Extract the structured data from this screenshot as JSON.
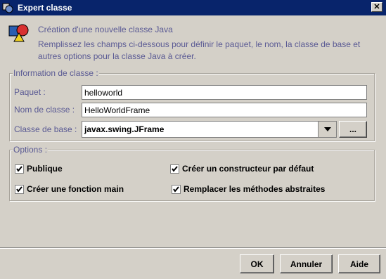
{
  "window": {
    "title": "Expert classe",
    "close_glyph": "✕",
    "app_icon": "java-class-icon"
  },
  "header": {
    "title": "Création d'une nouvelle classe Java",
    "description": "Remplissez les champs ci-dessous pour définir le paquet, le nom, la classe de base et autres options pour la classe Java à créer.",
    "icon": "shapes-icon"
  },
  "class_info": {
    "legend": "Information de classe :",
    "package_label": "Paquet :",
    "package_value": "helloworld",
    "class_name_label": "Nom de classe :",
    "class_name_value": "HelloWorldFrame",
    "base_class_label": "Classe de base :",
    "base_class_value": "javax.swing.JFrame",
    "browse_label": "..."
  },
  "options": {
    "legend": "Options :",
    "items": [
      {
        "label": "Publique",
        "checked": true
      },
      {
        "label": "Créer un constructeur par défaut",
        "checked": true
      },
      {
        "label": "Créer une fonction main",
        "checked": true
      },
      {
        "label": "Remplacer les méthodes abstraites",
        "checked": true
      }
    ]
  },
  "buttons": {
    "ok": "OK",
    "cancel": "Annuler",
    "help": "Aide"
  }
}
